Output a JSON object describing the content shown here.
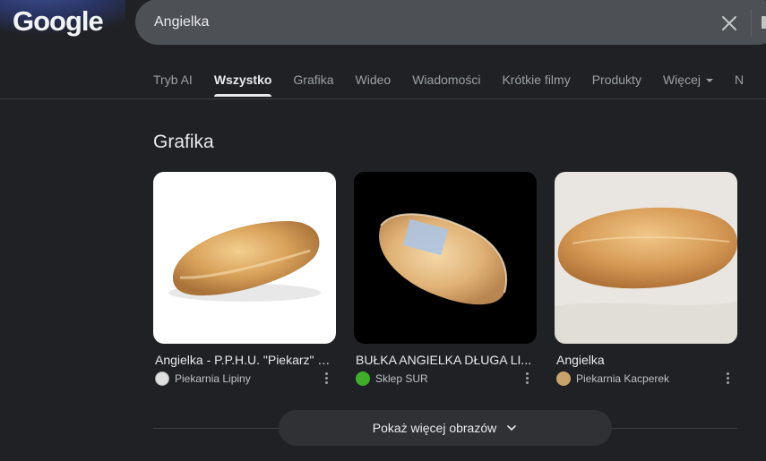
{
  "header": {
    "logo_text": "Google",
    "search_value": "Angielka"
  },
  "tabs": [
    {
      "label": "Tryb AI"
    },
    {
      "label": "Wszystko",
      "active": true
    },
    {
      "label": "Grafika"
    },
    {
      "label": "Wideo"
    },
    {
      "label": "Wiadomości"
    },
    {
      "label": "Krótkie filmy"
    },
    {
      "label": "Produkty"
    },
    {
      "label": "Więcej"
    },
    {
      "label": "N"
    }
  ],
  "images_section": {
    "title": "Grafika",
    "cards": [
      {
        "title": "Angielka - P.P.H.U. \"Piekarz\" S...",
        "source": "Piekarnia Lipiny"
      },
      {
        "title": "BUŁKA ANGIELKA DŁUGA LI...",
        "source": "Sklep SUR"
      },
      {
        "title": "Angielka",
        "source": "Piekarnia Kacperek"
      }
    ],
    "more_label": "Pokaż więcej obrazów"
  },
  "colors": {
    "background": "#202124",
    "search_box": "#4d5156",
    "text_primary": "#e8eaed",
    "text_secondary": "#9aa0a6"
  }
}
